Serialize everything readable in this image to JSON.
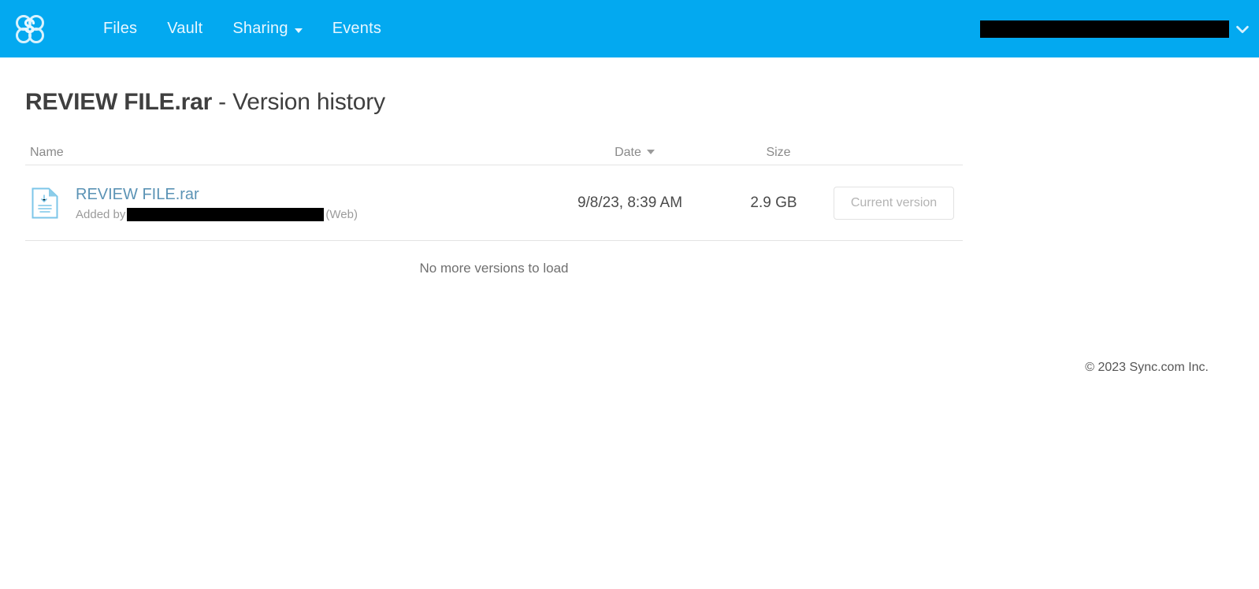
{
  "nav": {
    "logo_icon": "sync-cloverleaf-logo",
    "links": [
      {
        "label": "Files",
        "has_caret": false,
        "icon": ""
      },
      {
        "label": "Vault",
        "has_caret": false,
        "icon": ""
      },
      {
        "label": "Sharing",
        "has_caret": true,
        "icon": "chevron-down-icon"
      },
      {
        "label": "Events",
        "has_caret": false,
        "icon": ""
      }
    ],
    "account": {
      "name": "",
      "redacted": true,
      "chevron_icon": "chevron-down-icon"
    },
    "background_color": "#03a9f0",
    "text_color": "#e8f7ff"
  },
  "page": {
    "filename": "REVIEW FILE.rar",
    "title_suffix": " - Version history"
  },
  "table": {
    "headers": {
      "name": "Name",
      "date": "Date",
      "date_sort_icon": "caret-down-icon",
      "size": "Size"
    },
    "rows": [
      {
        "file_icon": "document-file-icon",
        "name": "REVIEW FILE.rar",
        "added_by_prefix": "Added by",
        "added_by_user": "",
        "added_by_redacted": true,
        "source": "(Web)",
        "date": "9/8/23, 8:39 AM",
        "size": "2.9 GB",
        "action_label": "Current version"
      }
    ]
  },
  "status": {
    "no_more": "No more versions to load"
  },
  "footer": {
    "copyright": "© 2023 Sync.com Inc."
  },
  "colors": {
    "brand_blue": "#03a9f0",
    "link_blue": "#5b93b5",
    "muted_text": "#9b9b9b",
    "border": "#e3e3e3"
  }
}
